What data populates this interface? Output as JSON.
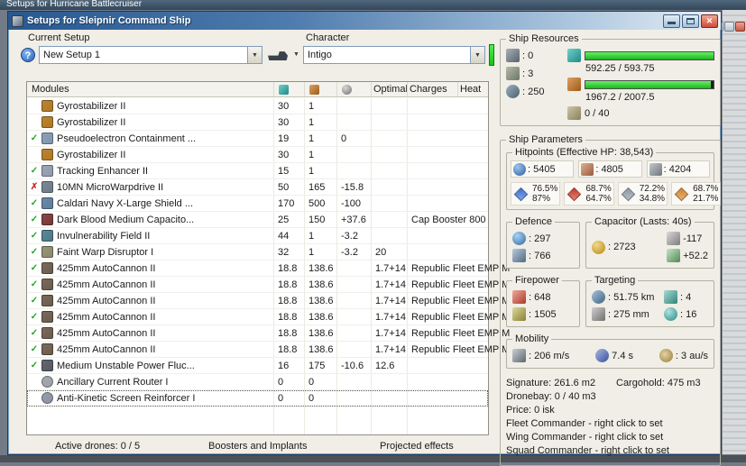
{
  "background_window": {
    "title": "Setups for Hurricane Battlecruiser"
  },
  "window": {
    "title": "Setups for Sleipnir Command Ship"
  },
  "icons": {
    "combo_arrow": "▼",
    "help": "?",
    "check": "✓",
    "cross": "✗",
    "close": "✕"
  },
  "toolbar": {
    "current_setup_label": "Current Setup",
    "current_setup_value": "New Setup 1",
    "character_label": "Character",
    "character_value": "Intigo"
  },
  "modules_table": {
    "headers": {
      "modules": "Modules",
      "optimal": "Optimal",
      "charges": "Charges",
      "heat": "Heat"
    },
    "rows": [
      {
        "status": "",
        "icon": "#b07820",
        "name": "Gyrostabilizer II",
        "cpu": "30",
        "pg": "1",
        "cap": "",
        "optimal": "",
        "charges": ""
      },
      {
        "status": "",
        "icon": "#b07820",
        "name": "Gyrostabilizer II",
        "cpu": "30",
        "pg": "1",
        "cap": "",
        "optimal": "",
        "charges": ""
      },
      {
        "status": "check",
        "icon": "#7f96ad",
        "name": "Pseudoelectron Containment ...",
        "cpu": "19",
        "pg": "1",
        "cap": "0",
        "optimal": "",
        "charges": ""
      },
      {
        "status": "",
        "icon": "#b07820",
        "name": "Gyrostabilizer II",
        "cpu": "30",
        "pg": "1",
        "cap": "",
        "optimal": "",
        "charges": ""
      },
      {
        "status": "check",
        "icon": "#8f9bac",
        "name": "Tracking Enhancer II",
        "cpu": "15",
        "pg": "1",
        "cap": "",
        "optimal": "",
        "charges": ""
      },
      {
        "status": "cross",
        "icon": "#6d7b8a",
        "name": "10MN MicroWarpdrive II",
        "cpu": "50",
        "pg": "165",
        "cap": "-15.8",
        "optimal": "",
        "charges": ""
      },
      {
        "status": "check",
        "icon": "#5d7d9d",
        "name": "Caldari Navy X-Large Shield ...",
        "cpu": "170",
        "pg": "500",
        "cap": "-100",
        "optimal": "",
        "charges": ""
      },
      {
        "status": "check",
        "icon": "#7a3535",
        "name": "Dark Blood Medium Capacito...",
        "cpu": "25",
        "pg": "150",
        "cap": "+37.6",
        "optimal": "",
        "charges": "Cap Booster 800"
      },
      {
        "status": "check",
        "icon": "#4a7a8a",
        "name": "Invulnerability Field II",
        "cpu": "44",
        "pg": "1",
        "cap": "-3.2",
        "optimal": "",
        "charges": ""
      },
      {
        "status": "check",
        "icon": "#8a8a6a",
        "name": "Faint Warp Disruptor I",
        "cpu": "32",
        "pg": "1",
        "cap": "-3.2",
        "optimal": "20",
        "charges": ""
      },
      {
        "status": "check",
        "icon": "#6b5b4b",
        "name": "425mm AutoCannon II",
        "cpu": "18.8",
        "pg": "138.6",
        "cap": "",
        "optimal": "1.7+14",
        "charges": "Republic Fleet EMP M"
      },
      {
        "status": "check",
        "icon": "#6b5b4b",
        "name": "425mm AutoCannon II",
        "cpu": "18.8",
        "pg": "138.6",
        "cap": "",
        "optimal": "1.7+14",
        "charges": "Republic Fleet EMP M"
      },
      {
        "status": "check",
        "icon": "#6b5b4b",
        "name": "425mm AutoCannon II",
        "cpu": "18.8",
        "pg": "138.6",
        "cap": "",
        "optimal": "1.7+14",
        "charges": "Republic Fleet EMP M"
      },
      {
        "status": "check",
        "icon": "#6b5b4b",
        "name": "425mm AutoCannon II",
        "cpu": "18.8",
        "pg": "138.6",
        "cap": "",
        "optimal": "1.7+14",
        "charges": "Republic Fleet EMP M"
      },
      {
        "status": "check",
        "icon": "#6b5b4b",
        "name": "425mm AutoCannon II",
        "cpu": "18.8",
        "pg": "138.6",
        "cap": "",
        "optimal": "1.7+14",
        "charges": "Republic Fleet EMP M"
      },
      {
        "status": "check",
        "icon": "#6b5b4b",
        "name": "425mm AutoCannon II",
        "cpu": "18.8",
        "pg": "138.6",
        "cap": "",
        "optimal": "1.7+14",
        "charges": "Republic Fleet EMP M"
      },
      {
        "status": "check",
        "icon": "#55585f",
        "name": "Medium Unstable Power Fluc...",
        "cpu": "16",
        "pg": "175",
        "cap": "-10.6",
        "optimal": "12.6",
        "charges": ""
      },
      {
        "status": "",
        "icon": "#9aa0a8",
        "shape": "circle",
        "name": "Ancillary Current Router I",
        "cpu": "0",
        "pg": "0",
        "cap": "",
        "optimal": "",
        "charges": ""
      },
      {
        "status": "",
        "icon": "#8a94a0",
        "shape": "circle",
        "name": "Anti-Kinetic Screen Reinforcer I",
        "cpu": "0",
        "pg": "0",
        "cap": "",
        "optimal": "",
        "charges": "",
        "selected": true
      }
    ]
  },
  "bottom_panels": {
    "active_drones": "Active drones: 0 / 5",
    "boosters": "Boosters and Implants",
    "projected": "Projected effects"
  },
  "ship_resources": {
    "title": "Ship Resources",
    "turrets": ": 0",
    "launchers": ": 3",
    "drones": ": 250",
    "cpu": "592.25 / 593.75",
    "powergrid": "1967.2 / 2007.5",
    "calibration": "0 / 40"
  },
  "ship_parameters": {
    "title": "Ship Parameters",
    "hitpoints": {
      "title": "Hitpoints (Effective HP: 38,543)",
      "shield": ": 5405",
      "armor": ": 4805",
      "hull": ": 4204",
      "resists": [
        {
          "type": "em",
          "color": "#3b6fd4",
          "shield": "76.5%",
          "armor": "87%"
        },
        {
          "type": "thermal",
          "color": "#c43b2a",
          "shield": "68.7%",
          "armor": "64.7%"
        },
        {
          "type": "kinetic",
          "color": "#8d98a5",
          "shield": "72.2%",
          "armor": "34.8%"
        },
        {
          "type": "explosive",
          "color": "#d4842a",
          "shield": "68.7%",
          "armor": "21.7%"
        }
      ]
    },
    "defence": {
      "title": "Defence",
      "value1": ": 297",
      "value2": ": 766"
    },
    "capacitor": {
      "title": "Capacitor (Lasts: 40s)",
      "amount": ": 2723",
      "delta1": "-117",
      "delta2": "+52.2"
    },
    "firepower": {
      "title": "Firepower",
      "volley": ": 648",
      "dps": ": 1505"
    },
    "targeting": {
      "title": "Targeting",
      "range": ": 51.75 km",
      "max_targets": ": 4",
      "sig_resolution": ": 275 mm",
      "sensor_strength": ": 16"
    },
    "mobility": {
      "title": "Mobility",
      "speed": ": 206 m/s",
      "align_time": "7.4 s",
      "warp_speed": ": 3 au/s"
    },
    "info": {
      "signature": "Signature: 261.6 m2",
      "cargohold": "Cargohold: 475 m3",
      "dronebay": "Dronebay: 0 / 40 m3",
      "price": "Price: 0 isk",
      "fleet_commander": "Fleet Commander - right click to set",
      "wing_commander": "Wing Commander - right click to set",
      "squad_commander": "Squad Commander - right click to set"
    }
  }
}
